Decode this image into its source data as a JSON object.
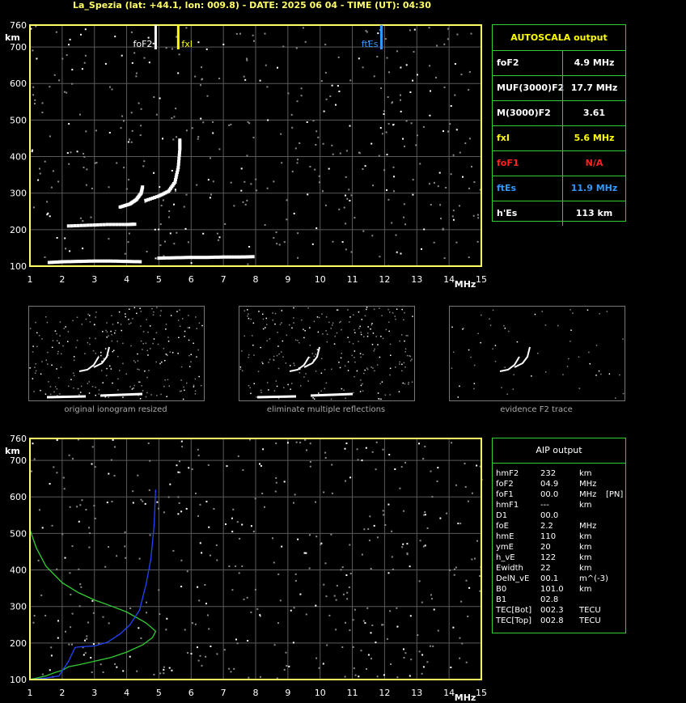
{
  "header": {
    "title": "La_Spezia (lat: +44.1, lon: 009.8) - DATE: 2025 06 04 - TIME (UT): 04:30"
  },
  "chart_data": [
    {
      "type": "scatter",
      "title": "",
      "xlabel": "MHz",
      "ylabel": "km",
      "xlim": [
        1,
        15
      ],
      "ylim": [
        100,
        760
      ],
      "x_ticks": [
        "1",
        "2",
        "3",
        "4",
        "5",
        "6",
        "7",
        "8",
        "9",
        "10",
        "11",
        "12",
        "13",
        "14",
        "15"
      ],
      "y_ticks": [
        "100",
        "200",
        "300",
        "400",
        "500",
        "600",
        "700",
        "760"
      ],
      "markers": [
        {
          "label": "foF2",
          "x": 4.9,
          "color": "#ffffff"
        },
        {
          "label": "fxI",
          "x": 5.6,
          "color": "#ffff00"
        },
        {
          "label": "ftEs",
          "x": 11.9,
          "color": "#3399ff"
        }
      ],
      "traces": [
        {
          "name": "",
          "points": [
            [
              1.6,
              110
            ],
            [
              2.0,
              112
            ],
            [
              2.5,
              113
            ],
            [
              3.0,
              114
            ],
            [
              3.5,
              114
            ],
            [
              4.0,
              113
            ],
            [
              4.5,
              112
            ]
          ]
        },
        {
          "name": "",
          "points": [
            [
              5.0,
              122
            ],
            [
              5.5,
              123
            ],
            [
              6.0,
              124
            ],
            [
              6.5,
              124
            ],
            [
              7.0,
              125
            ],
            [
              7.5,
              125
            ],
            [
              8.0,
              126
            ]
          ]
        },
        {
          "name": "",
          "points": [
            [
              2.2,
              210
            ],
            [
              2.8,
              212
            ],
            [
              3.4,
              214
            ],
            [
              4.0,
              214
            ],
            [
              4.3,
              215
            ]
          ]
        },
        {
          "name": "",
          "points": [
            [
              3.8,
              262
            ],
            [
              4.1,
              270
            ],
            [
              4.3,
              282
            ],
            [
              4.45,
              300
            ],
            [
              4.5,
              320
            ]
          ]
        },
        {
          "name": "",
          "points": [
            [
              4.6,
              280
            ],
            [
              5.0,
              292
            ],
            [
              5.3,
              305
            ],
            [
              5.5,
              330
            ],
            [
              5.6,
              370
            ],
            [
              5.65,
              420
            ],
            [
              5.65,
              450
            ]
          ]
        }
      ]
    },
    {
      "type": "scatter",
      "title": "",
      "xlabel": "MHz",
      "ylabel": "km",
      "xlim": [
        1,
        15
      ],
      "ylim": [
        100,
        760
      ],
      "x_ticks": [
        "1",
        "2",
        "3",
        "4",
        "5",
        "6",
        "7",
        "8",
        "9",
        "10",
        "11",
        "12",
        "13",
        "14",
        "15"
      ],
      "y_ticks": [
        "100",
        "200",
        "300",
        "400",
        "500",
        "600",
        "700",
        "760"
      ],
      "series": [
        {
          "name": "",
          "color": "#33cc33",
          "points": [
            [
              1.0,
              510
            ],
            [
              1.2,
              460
            ],
            [
              1.5,
              410
            ],
            [
              2.0,
              365
            ],
            [
              2.5,
              338
            ],
            [
              3.0,
              318
            ],
            [
              3.5,
              302
            ],
            [
              4.0,
              285
            ],
            [
              4.3,
              270
            ],
            [
              4.6,
              255
            ],
            [
              4.8,
              240
            ],
            [
              4.9,
              232
            ],
            [
              4.8,
              215
            ],
            [
              4.5,
              195
            ],
            [
              4.0,
              175
            ],
            [
              3.5,
              160
            ],
            [
              3.0,
              150
            ],
            [
              2.5,
              140
            ],
            [
              2.2,
              135
            ],
            [
              2.0,
              125
            ],
            [
              1.8,
              120
            ],
            [
              1.5,
              110
            ],
            [
              1.0,
              100
            ]
          ]
        },
        {
          "name": "",
          "color": "#2244ff",
          "points": [
            [
              1.0,
              100
            ],
            [
              1.5,
              104
            ],
            [
              1.9,
              110
            ],
            [
              2.2,
              150
            ],
            [
              2.4,
              188
            ],
            [
              2.6,
              190
            ],
            [
              3.0,
              192
            ],
            [
              3.4,
              202
            ],
            [
              3.8,
              225
            ],
            [
              4.1,
              250
            ],
            [
              4.4,
              290
            ],
            [
              4.6,
              360
            ],
            [
              4.75,
              430
            ],
            [
              4.85,
              520
            ],
            [
              4.9,
              620
            ]
          ]
        }
      ]
    }
  ],
  "autoscala": {
    "title": "AUTOSCALA output",
    "rows": [
      {
        "key": "foF2",
        "value": "4.9 MHz",
        "color": "#ffffff"
      },
      {
        "key": "MUF(3000)F2",
        "value": "17.7 MHz",
        "color": "#ffffff"
      },
      {
        "key": "M(3000)F2",
        "value": "3.61",
        "color": "#ffffff"
      },
      {
        "key": "fxI",
        "value": "5.6 MHz",
        "color": "#ffff00"
      },
      {
        "key": "foF1",
        "value": "N/A",
        "color": "#ff2222"
      },
      {
        "key": "ftEs",
        "value": "11.9 MHz",
        "color": "#3399ff"
      },
      {
        "key": "h'Es",
        "value": "113     km",
        "color": "#ffffff"
      }
    ]
  },
  "thumbnails": [
    {
      "caption": "original ionogram resized"
    },
    {
      "caption": "eliminate multiple reflections"
    },
    {
      "caption": "evidence F2 trace"
    }
  ],
  "aip": {
    "title": "AIP output",
    "rows": [
      {
        "key": "hmF2",
        "value": "232",
        "unit": "km",
        "extra": ""
      },
      {
        "key": "foF2",
        "value": "04.9",
        "unit": "MHz",
        "extra": ""
      },
      {
        "key": "foF1",
        "value": "00.0",
        "unit": "MHz",
        "extra": "[PN]"
      },
      {
        "key": "hmF1",
        "value": "---",
        "unit": "km",
        "extra": ""
      },
      {
        "key": "D1",
        "value": "00.0",
        "unit": "",
        "extra": ""
      },
      {
        "key": "foE",
        "value": "2.2",
        "unit": "MHz",
        "extra": ""
      },
      {
        "key": "hmE",
        "value": "110",
        "unit": "km",
        "extra": ""
      },
      {
        "key": "ymE",
        "value": "20",
        "unit": "km",
        "extra": ""
      },
      {
        "key": "h_vE",
        "value": "122",
        "unit": "km",
        "extra": ""
      },
      {
        "key": "Ewidth",
        "value": "22",
        "unit": "km",
        "extra": ""
      },
      {
        "key": "DelN_vE",
        "value": "00.1",
        "unit": "m^(-3)",
        "extra": ""
      },
      {
        "key": "B0",
        "value": "101.0",
        "unit": "km",
        "extra": ""
      },
      {
        "key": "B1",
        "value": "02.8",
        "unit": "",
        "extra": ""
      },
      {
        "key": "TEC[Bot]",
        "value": "002.3",
        "unit": "TECU",
        "extra": ""
      },
      {
        "key": "TEC[Top]",
        "value": "002.8",
        "unit": "TECU",
        "extra": ""
      }
    ]
  }
}
